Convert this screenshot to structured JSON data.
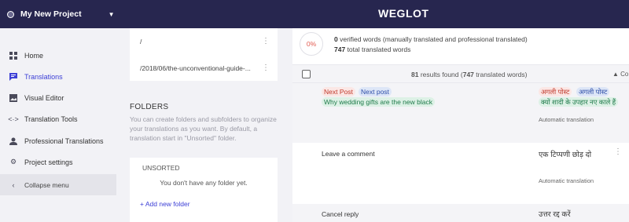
{
  "header": {
    "project_name": "My New Project",
    "brand": "WEGLOT"
  },
  "sidebar": {
    "items": [
      {
        "label": "Home",
        "icon": "grid-icon"
      },
      {
        "label": "Translations",
        "icon": "chat-icon",
        "active": true
      },
      {
        "label": "Visual Editor",
        "icon": "image-edit-icon"
      },
      {
        "label": "Translation Tools",
        "icon": "code-icon"
      },
      {
        "label": "Professional Translations",
        "icon": "user-icon"
      },
      {
        "label": "Project settings",
        "icon": "gear-icon"
      }
    ],
    "collapse_label": "Collapse menu"
  },
  "urls": [
    {
      "path": "/"
    },
    {
      "path": "/2018/06/the-unconventional-guide-..."
    }
  ],
  "folders": {
    "heading": "FOLDERS",
    "description": "You can create folders and subfolders to organize your translations as you want. By default, a translation start in \"Unsorted\" folder.",
    "unsorted_label": "UNSORTED",
    "empty_text": "You don't have any folder yet.",
    "add_label": "+ Add new folder"
  },
  "stats": {
    "percent": "0%",
    "verified_count": "0",
    "verified_text": "verified words (manually translated and professional translated)",
    "total_count": "747",
    "total_text": "total translated words"
  },
  "results": {
    "count": "81",
    "text_before": "results found (",
    "translated_count": "747",
    "text_after": "translated words)",
    "sort_label": "▲ Co"
  },
  "rows": [
    {
      "source_tags": [
        "Next Post",
        "Next post",
        "Why wedding gifts are the new black"
      ],
      "translation_tags": [
        "अगली पोस्ट",
        "अगली पोस्ट",
        "क्यों शादी के उपहार नए काले हैं"
      ],
      "type": "Automatic translation"
    },
    {
      "source": "Leave a comment",
      "translation": "एक टिप्पणी छोड़ दो",
      "type": "Automatic translation"
    },
    {
      "source": "Cancel reply",
      "translation": "उत्तर रद्द करें"
    }
  ],
  "colors": {
    "topbar": "#27264f",
    "accent": "#3d40d6",
    "percent_red": "#e25a4f"
  }
}
